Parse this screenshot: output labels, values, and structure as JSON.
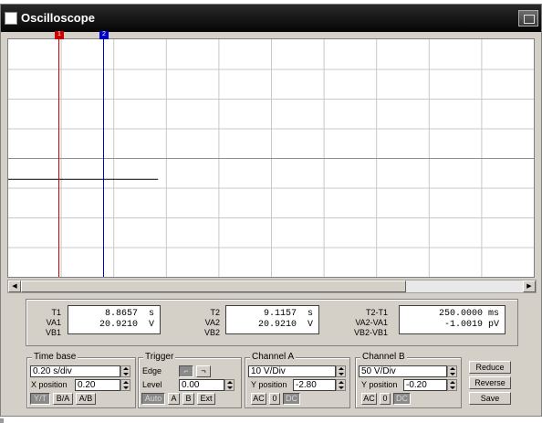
{
  "window": {
    "title": "Oscilloscope"
  },
  "cursors": {
    "c1": "1",
    "c2": "2",
    "c1_color": "#cc0000",
    "c2_color": "#0000cc"
  },
  "trace": {
    "color": "#000000",
    "level_divs": 0.7,
    "end_fraction": 0.285
  },
  "grid": {
    "cols": 10,
    "rows": 8,
    "color": "#c8c8c8"
  },
  "readout": {
    "t1_label": "T1",
    "va1_label": "VA1",
    "vb1_label": "VB1",
    "t1_value": "8.8657  s",
    "va1_value": "20.9210  V",
    "t2_label": "T2",
    "va2_label": "VA2",
    "vb2_label": "VB2",
    "t2_value": "9.1157  s",
    "va2_value": "20.9210  V",
    "d_t_label": "T2-T1",
    "d_va_label": "VA2-VA1",
    "d_vb_label": "VB2-VB1",
    "d_t_value": "250.0000 ms",
    "d_va_value": "-1.0019 pV"
  },
  "timebase": {
    "title": "Time base",
    "scale": "0.20 s/div",
    "xpos_label": "X position",
    "xpos_value": "0.20",
    "btn_yt": "Y/T",
    "btn_ba": "B/A",
    "btn_ab": "A/B"
  },
  "trigger": {
    "title": "Trigger",
    "edge_label": "Edge",
    "level_label": "Level",
    "level_value": "0.00",
    "btn_auto": "Auto",
    "btn_a": "A",
    "btn_b": "B",
    "btn_ext": "Ext"
  },
  "channel_a": {
    "title": "Channel A",
    "scale": "10 V/Div",
    "ypos_label": "Y position",
    "ypos_value": "-2.80",
    "btn_ac": "AC",
    "btn_0": "0",
    "btn_dc": "DC"
  },
  "channel_b": {
    "title": "Channel B",
    "scale": "50 V/Div",
    "ypos_label": "Y position",
    "ypos_value": "-0.20",
    "btn_ac": "AC",
    "btn_0": "0",
    "btn_dc": "DC"
  },
  "side_buttons": {
    "reduce": "Reduce",
    "reverse": "Reverse",
    "save": "Save"
  }
}
